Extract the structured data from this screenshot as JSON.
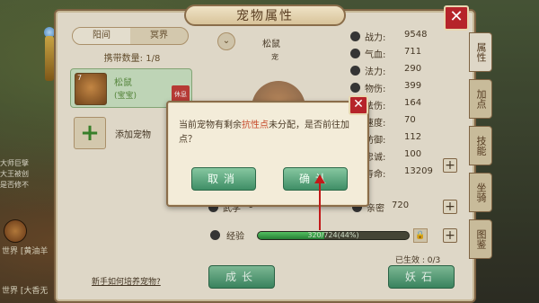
{
  "window": {
    "title": "宠物属性"
  },
  "left_panel": {
    "tabs": [
      {
        "label": "阳间",
        "active": true
      },
      {
        "label": "冥界",
        "active": false
      }
    ],
    "carry_count": "携带数量: 1/8",
    "pets": [
      {
        "name": "松鼠",
        "tag": "(宝宝)",
        "level": "7",
        "state": "休息"
      }
    ],
    "add_pet_label": "添加宠物",
    "help_link": "新手如何培养宠物?"
  },
  "pet_stage": {
    "name": "松鼠",
    "sub": "宠"
  },
  "stats": [
    {
      "label": "战力:",
      "value": "9548"
    },
    {
      "label": "气血:",
      "value": "711"
    },
    {
      "label": "法力:",
      "value": "290"
    },
    {
      "label": "物伤:",
      "value": "399"
    },
    {
      "label": "法伤:",
      "value": "164"
    },
    {
      "label": "速度:",
      "value": "70"
    },
    {
      "label": "防御:",
      "value": "112"
    },
    {
      "label": "忠诚:",
      "value": "100"
    },
    {
      "label": "寿命:",
      "value": "13209"
    }
  ],
  "bottom": {
    "wuxue_label": "武学",
    "wuxue_value": "0",
    "qinmi_label": "亲密",
    "qinmi_value": "720",
    "exp_label": "经验",
    "exp_text": "320/724(44%)",
    "exp_progress": 0.44,
    "effective": "已生效 : 0/3",
    "grow_button": "成长",
    "yaoshi_button": "妖石"
  },
  "side_tabs": [
    {
      "label": "属性",
      "active": true
    },
    {
      "label": "加点",
      "active": false
    },
    {
      "label": "技能",
      "active": false
    },
    {
      "label": "坐骑",
      "active": false
    },
    {
      "label": "图鉴",
      "active": false
    }
  ],
  "dialog": {
    "message_pre": "当前宠物有剩余",
    "message_highlight": "抗性点",
    "message_post": "未分配，是否前往加点？",
    "cancel_label": "取消",
    "confirm_label": "确认"
  },
  "chat": {
    "lines": [
      "大师巨擘",
      "大王被创",
      "是否修不"
    ],
    "channels": [
      "世界 [黄油羊",
      "世界 [大香无"
    ]
  },
  "colors": {
    "highlight": "#c64a2a",
    "button_green": "#3f8e66",
    "close_red": "#b6242a",
    "arrow_red": "#c21a1a"
  }
}
